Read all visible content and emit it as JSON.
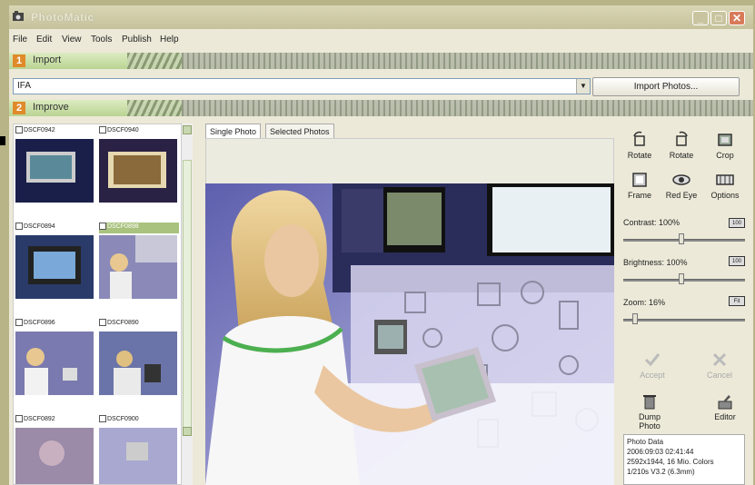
{
  "window": {
    "title": "PhotoMatic"
  },
  "menu": [
    "File",
    "Edit",
    "View",
    "Tools",
    "Publish",
    "Help"
  ],
  "sections": {
    "import": {
      "number": "1",
      "label": "Import"
    },
    "improve": {
      "number": "2",
      "label": "Improve"
    }
  },
  "import": {
    "path": "IFA",
    "button_label": "Import Photos..."
  },
  "thumbnails": [
    {
      "name": "DSCF0942",
      "selected": false
    },
    {
      "name": "DSCF0940",
      "selected": false
    },
    {
      "name": "DSCF0894",
      "selected": false
    },
    {
      "name": "DSCF0898",
      "selected": true
    },
    {
      "name": "DSCF0896",
      "selected": false
    },
    {
      "name": "DSCF0890",
      "selected": false
    },
    {
      "name": "DSCF0892",
      "selected": false
    },
    {
      "name": "DSCF0900",
      "selected": false
    }
  ],
  "tabs": [
    "Single Photo",
    "Selected Photos"
  ],
  "tools": {
    "rotate_left": "Rotate",
    "rotate_right": "Rotate",
    "crop": "Crop",
    "frame": "Frame",
    "red_eye": "Red Eye",
    "options": "Options",
    "accept": "Accept",
    "cancel": "Cancel",
    "dump": "Dump Photo",
    "editor": "Editor"
  },
  "sliders": {
    "contrast": {
      "label": "Contrast: 100%",
      "value": 100
    },
    "brightness": {
      "label": "Brightness: 100%",
      "value": 100
    },
    "zoom": {
      "label": "Zoom: 16%",
      "value": 16
    }
  },
  "photo_data": {
    "heading": "Photo Data",
    "datetime": "2006:09:03 02:41:44",
    "size": "2592x1944, 16 Mio. Colors",
    "exposure": "1/210s  V3.2  (6.3mm)"
  },
  "colors": {
    "accent": "#a9c27d",
    "section_number": "#e08a2a"
  }
}
